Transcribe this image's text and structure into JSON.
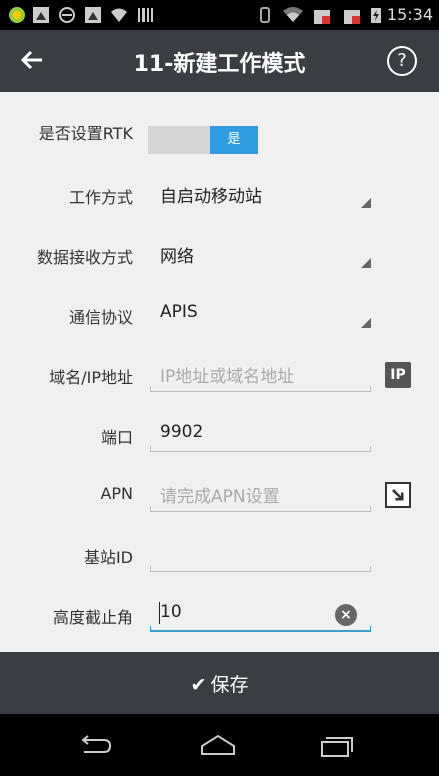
{
  "status_bar": {
    "time": "15:34"
  },
  "app_bar": {
    "title": "11-新建工作模式",
    "help": "?"
  },
  "form": {
    "rtk": {
      "label": "是否设置RTK",
      "value": "是"
    },
    "work_mode": {
      "label": "工作方式",
      "value": "自启动移动站"
    },
    "data_receive": {
      "label": "数据接收方式",
      "value": "网络"
    },
    "protocol": {
      "label": "通信协议",
      "value": "APIS"
    },
    "domain": {
      "label": "域名/IP地址",
      "placeholder": "IP地址或域名地址",
      "icon_text": "IP"
    },
    "port": {
      "label": "端口",
      "value": "9902"
    },
    "apn": {
      "label": "APN",
      "placeholder": "请完成APN设置"
    },
    "station_id": {
      "label": "基站ID",
      "value": ""
    },
    "elevation": {
      "label": "高度截止角",
      "value": "10"
    }
  },
  "save": {
    "label": "保存"
  },
  "colors": {
    "accent": "#2f9de0",
    "bar": "#3a3e43"
  }
}
